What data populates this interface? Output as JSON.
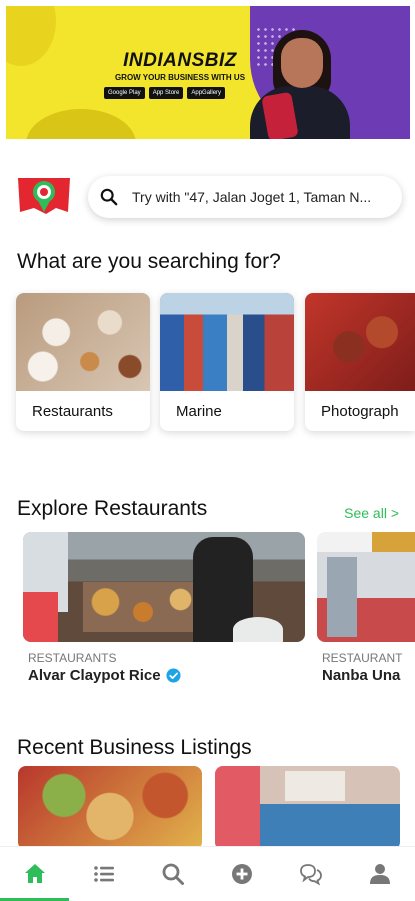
{
  "banner": {
    "brand": "INDIANSBIZ",
    "tagline": "GROW YOUR BUSINESS WITH US",
    "stores": [
      "Google Play",
      "App Store",
      "AppGallery"
    ]
  },
  "search": {
    "placeholder": "Try with \"47, Jalan Joget 1, Taman N..."
  },
  "categories": {
    "heading": "What are you searching for?",
    "items": [
      {
        "label": "Restaurants"
      },
      {
        "label": "Marine"
      },
      {
        "label": "Photograph"
      }
    ]
  },
  "explore": {
    "heading": "Explore Restaurants",
    "see_all": "See all >",
    "items": [
      {
        "category": "RESTAURANTS",
        "name": "Alvar Claypot Rice",
        "verified": true
      },
      {
        "category": "RESTAURANT",
        "name": "Nanba Una"
      }
    ]
  },
  "recent": {
    "heading": "Recent Business Listings"
  },
  "tabbar": {
    "active": "home",
    "accent": "#2ebd59",
    "icon_color": "#777777",
    "tabs": [
      {
        "icon": "home-icon"
      },
      {
        "icon": "list-icon"
      },
      {
        "icon": "search-icon"
      },
      {
        "icon": "add-circle-icon"
      },
      {
        "icon": "chat-icon"
      },
      {
        "icon": "profile-icon"
      }
    ]
  }
}
